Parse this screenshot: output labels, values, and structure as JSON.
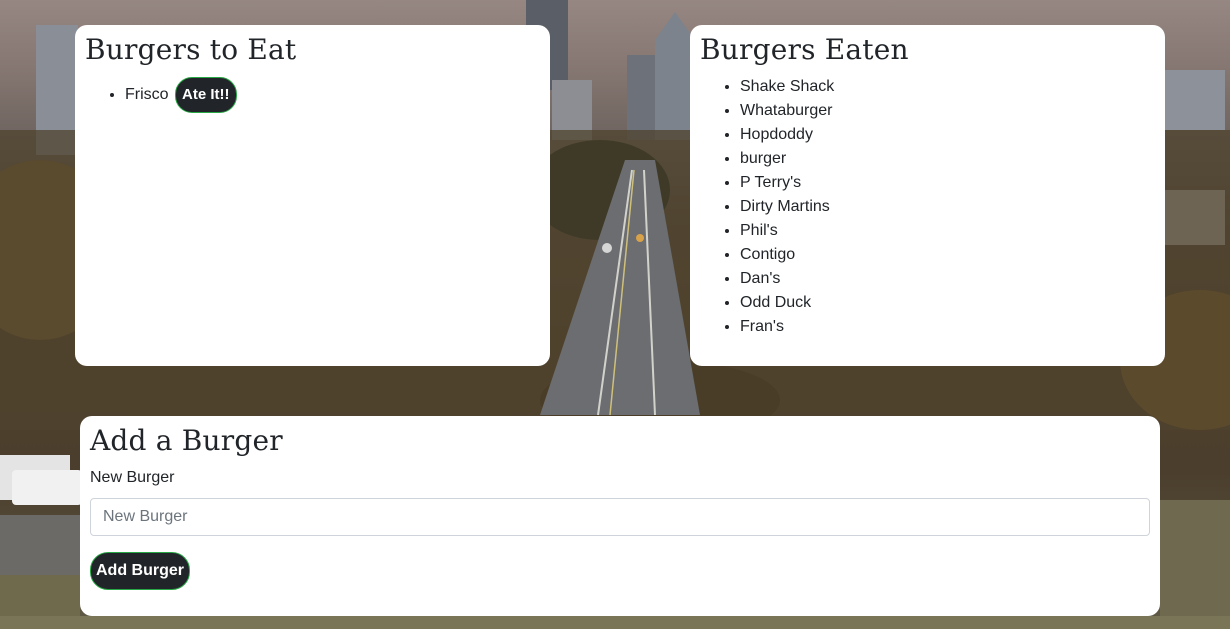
{
  "to_eat": {
    "title": "Burgers to Eat",
    "items": [
      {
        "name": "Frisco",
        "action_label": "Ate It!!"
      }
    ]
  },
  "eaten": {
    "title": "Burgers Eaten",
    "items": [
      "Shake Shack",
      "Whataburger",
      "Hopdoddy",
      "burger",
      "P Terry's",
      "Dirty Martins",
      "Phil's",
      "Contigo",
      "Dan's",
      "Odd Duck",
      "Fran's"
    ]
  },
  "add_form": {
    "title": "Add a Burger",
    "label": "New Burger",
    "input_value": "",
    "input_placeholder": "New Burger",
    "submit_label": "Add Burger"
  },
  "colors": {
    "button_bg": "#212529",
    "button_border": "#28a745",
    "card_bg": "#ffffff"
  }
}
